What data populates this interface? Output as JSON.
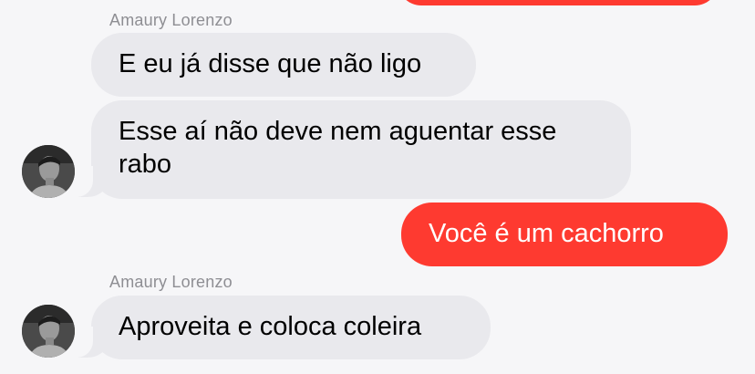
{
  "conversation": {
    "top_bubble": {
      "direction": "outgoing",
      "text": ""
    },
    "groups": [
      {
        "sender": "Amaury Lorenzo",
        "messages": [
          "E eu já disse que não ligo",
          "Esse aí não deve nem aguentar esse\nrabo"
        ]
      },
      {
        "outgoing": "Você é um cachorro"
      },
      {
        "sender": "Amaury Lorenzo",
        "messages": [
          "Aproveita e coloca coleira"
        ]
      }
    ]
  },
  "colors": {
    "outgoing_bubble": "#fe3a30",
    "incoming_bubble": "#e9e9ed",
    "background": "#f6f6f8",
    "sender_name": "#8e8e93"
  },
  "icons": {
    "avatar": "person-photo"
  }
}
